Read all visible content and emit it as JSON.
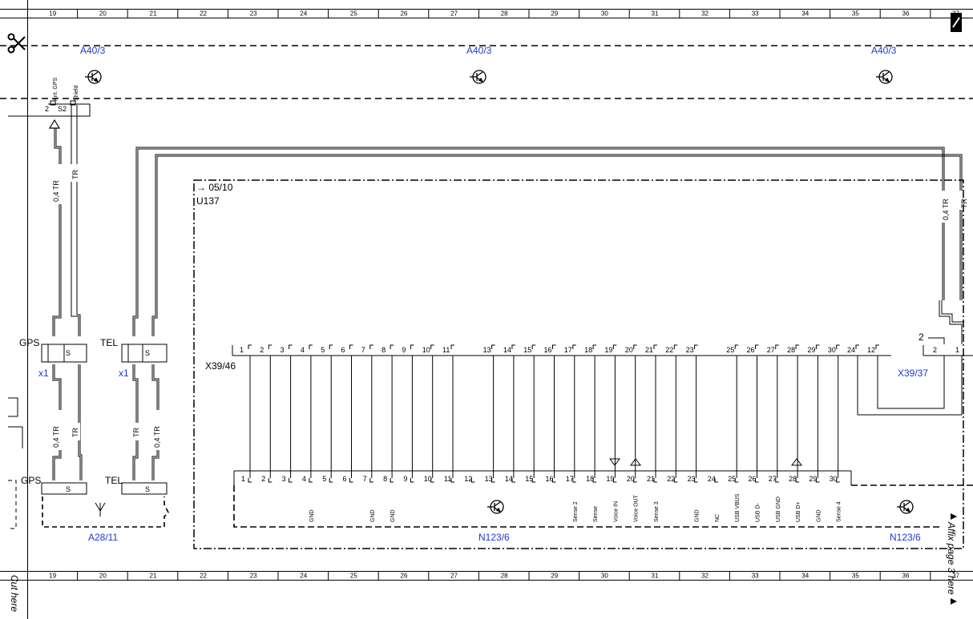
{
  "ruler": {
    "columns": [
      "19",
      "20",
      "21",
      "22",
      "23",
      "24",
      "25",
      "26",
      "27",
      "28",
      "29",
      "30",
      "31",
      "32",
      "33",
      "34",
      "35",
      "36",
      "37"
    ]
  },
  "margin_text": {
    "cut_here": "Cut here",
    "affix_page": "Affix page 3 here"
  },
  "ground_refs": {
    "top": [
      "A40/3",
      "A40/3",
      "A40/3"
    ],
    "bottom_right": "N123/6"
  },
  "antenna_connector": {
    "pin2": "2",
    "shield_label": "S2",
    "ant_gps": "Ant. GPS",
    "shield": "Shield"
  },
  "wires": {
    "gps_upper_a": "0,4 TR",
    "gps_upper_b": "TR",
    "gps_lower_a": "0,4 TR",
    "gps_lower_b": "TR",
    "tel_lower_a": "TR",
    "tel_lower_b": "0,4 TR",
    "right_a": "0,4 TR",
    "right_b": "TR"
  },
  "couplers": {
    "gps": "GPS",
    "tel": "TEL",
    "gps_bottom": "GPS",
    "tel_bottom": "TEL",
    "x1": "x1",
    "s": "S"
  },
  "module": {
    "ref": "→ 05/10",
    "name": "U137"
  },
  "connector_x39_46": {
    "name": "X39/46",
    "pins": [
      "1",
      "2",
      "3",
      "4",
      "5",
      "6",
      "7",
      "8",
      "9",
      "10",
      "11",
      "13",
      "14",
      "15",
      "16",
      "17",
      "18",
      "19",
      "20",
      "21",
      "22",
      "23",
      "25",
      "26",
      "27",
      "28",
      "29",
      "30",
      "24",
      "12"
    ]
  },
  "connector_x39_37": {
    "name": "X39/37",
    "pins": [
      "2",
      "1"
    ],
    "pin_side": "2"
  },
  "unit_n123_6": {
    "name": "N123/6",
    "name_right": "N123/6",
    "pins": [
      "1",
      "2",
      "3",
      "4",
      "5",
      "6",
      "7",
      "8",
      "9",
      "10",
      "11",
      "12",
      "13",
      "14",
      "15",
      "16",
      "17",
      "18",
      "19",
      "20",
      "21",
      "22",
      "23",
      "24",
      "25",
      "26",
      "27",
      "28",
      "29",
      "30"
    ],
    "signals": [
      {
        "pin": "4",
        "label": "GND"
      },
      {
        "pin": "7",
        "label": "GND"
      },
      {
        "pin": "8",
        "label": "GND"
      },
      {
        "pin": "17",
        "label": "Sense 2"
      },
      {
        "pin": "18",
        "label": "Sense"
      },
      {
        "pin": "19",
        "label": "Voice IN"
      },
      {
        "pin": "20",
        "label": "Voice OUT"
      },
      {
        "pin": "21",
        "label": "Sense 3"
      },
      {
        "pin": "23",
        "label": "GND"
      },
      {
        "pin": "24",
        "label": "NC"
      },
      {
        "pin": "25",
        "label": "USB VBUS"
      },
      {
        "pin": "26",
        "label": "USB D-"
      },
      {
        "pin": "27",
        "label": "USB GND"
      },
      {
        "pin": "28",
        "label": "USB D+"
      },
      {
        "pin": "29",
        "label": "GND"
      },
      {
        "pin": "30",
        "label": "Sense 4"
      }
    ]
  },
  "antenna_unit": {
    "name": "A28/11"
  },
  "colors": {
    "ink": "#000000",
    "ref_blue": "#1c39d4"
  }
}
